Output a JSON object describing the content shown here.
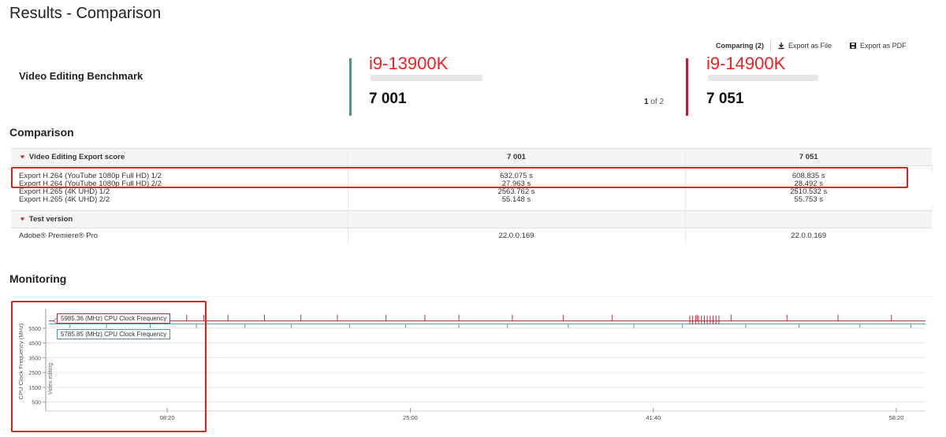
{
  "page": {
    "title": "Results - Comparison"
  },
  "toolbar": {
    "comparing": "Comparing (2)",
    "export_file": "Export as File",
    "export_pdf": "Export as PDF"
  },
  "benchmark": {
    "name": "Video Editing Benchmark",
    "pager_current": "1",
    "pager_rest": " of 2",
    "results": [
      {
        "cpu": "i9-13900K",
        "score": "7 001",
        "accent": "#3a9c9a"
      },
      {
        "cpu": "i9-14900K",
        "score": "7 051",
        "accent": "#a32b38"
      }
    ]
  },
  "comparison": {
    "title": "Comparison",
    "group_export": {
      "label": "Video Editing Export score",
      "score_a": "7 001",
      "score_b": "7 051"
    },
    "rows": [
      {
        "label": "Export H.264 (YouTube 1080p Full HD) 1/2",
        "a": "632.075 s",
        "b": "608.835 s"
      },
      {
        "label": "Export H.264 (YouTube 1080p Full HD) 2/2",
        "a": "27.963 s",
        "b": "28.492 s"
      },
      {
        "label": "Export H.265 (4K UHD) 1/2",
        "a": "2563.762 s",
        "b": "2510.532 s"
      },
      {
        "label": "Export H.265 (4K UHD) 2/2",
        "a": "55.148 s",
        "b": "55.753 s"
      }
    ],
    "group_version": {
      "label": "Test version"
    },
    "version_row": {
      "label": "Adobe® Premiere® Pro",
      "a": "22.0.0.169",
      "b": "22.0.0.169"
    }
  },
  "monitoring": {
    "title": "Monitoring",
    "tooltip_red": "5985.36 (MHz) CPU Clock Frequency",
    "tooltip_teal": "5785.85 (MHz) CPU Clock Frequency"
  },
  "chart_data": {
    "type": "line",
    "ylabel": "CPU Clock Frequency (MHz)",
    "band_label": "Video editing",
    "ylim": [
      0,
      6500
    ],
    "yticks": [
      500,
      1500,
      2500,
      3500,
      4500,
      5500
    ],
    "ytick_labels": [
      "500",
      "1500",
      "2500",
      "3500",
      "4500",
      "5500"
    ],
    "xlim_sec": [
      0,
      3620
    ],
    "xticks_sec": [
      500,
      1500,
      2500,
      3500
    ],
    "xtick_labels": [
      "08:20",
      "25:00",
      "41:40",
      "58:20"
    ],
    "series": [
      {
        "color": "#b0303c",
        "base": 5985.36,
        "dips_sec": [
          60,
          190,
          310,
          390,
          470,
          580,
          650,
          750,
          900,
          1050,
          1200,
          1400,
          1560,
          1700,
          1920,
          2130,
          2330,
          2680,
          2820,
          3050,
          3260,
          3480
        ]
      },
      {
        "color": "#4a9aa8",
        "base": 5785.85,
        "dips_sec": [
          100,
          250,
          430,
          620,
          820,
          1010,
          1250,
          1480,
          1700,
          1900,
          2150,
          2420,
          2620,
          2880,
          3100,
          3350,
          3560
        ]
      }
    ]
  }
}
